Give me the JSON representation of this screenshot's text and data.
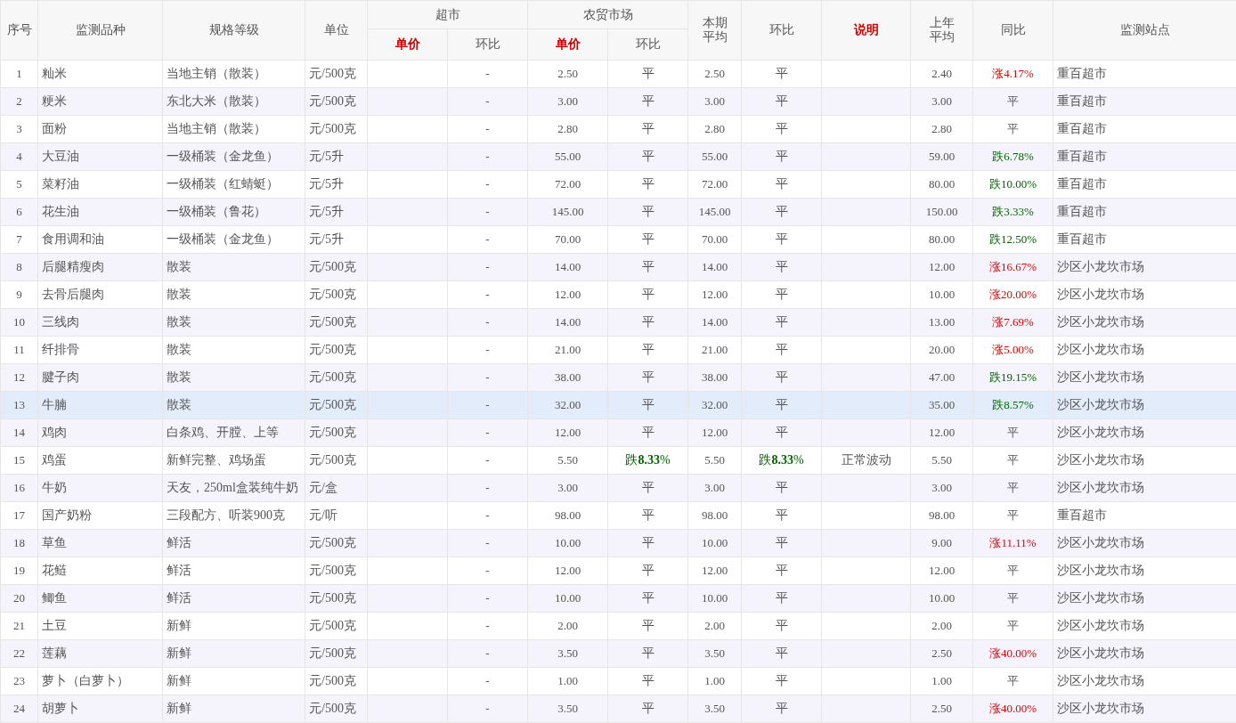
{
  "header": [
    {
      "label": "序号",
      "emphasis": false
    },
    {
      "label": "监测品种",
      "emphasis": false
    },
    {
      "label": "规格等级",
      "emphasis": false
    },
    {
      "label": "单位",
      "emphasis": false
    },
    {
      "label": "超市",
      "emphasis": false,
      "sub": [
        {
          "label": "单价",
          "emphasis": true
        },
        {
          "label": "环比",
          "emphasis": false
        }
      ]
    },
    {
      "label": "农贸市场",
      "emphasis": false,
      "sub": [
        {
          "label": "单价",
          "emphasis": true
        },
        {
          "label": "环比",
          "emphasis": false
        }
      ]
    },
    {
      "label": "本期平均",
      "emphasis": false
    },
    {
      "label": "环比",
      "emphasis": false
    },
    {
      "label": "说明",
      "emphasis": true
    },
    {
      "label": "上年平均",
      "emphasis": false
    },
    {
      "label": "同比",
      "emphasis": false
    },
    {
      "label": "监测站点",
      "emphasis": false
    }
  ],
  "rows": [
    {
      "no": "1",
      "name": "籼米",
      "spec": "当地主销（散装）",
      "unit": "元/500克",
      "super_change": "-",
      "farm_price": "2.50",
      "farm_change": {
        "text": "平",
        "kind": "flat"
      },
      "avg": "2.50",
      "avg_change": {
        "text": "平",
        "kind": "flat"
      },
      "last_year": "2.40",
      "yoy": {
        "text": "涨4.17%",
        "kind": "up"
      },
      "station": "重百超市",
      "selected": false
    },
    {
      "no": "2",
      "name": "粳米",
      "spec": "东北大米（散装）",
      "unit": "元/500克",
      "super_change": "-",
      "farm_price": "3.00",
      "farm_change": {
        "text": "平",
        "kind": "flat"
      },
      "avg": "3.00",
      "avg_change": {
        "text": "平",
        "kind": "flat"
      },
      "last_year": "3.00",
      "yoy": {
        "text": "平",
        "kind": "flat"
      },
      "station": "重百超市",
      "selected": false
    },
    {
      "no": "3",
      "name": "面粉",
      "spec": "当地主销（散装）",
      "unit": "元/500克",
      "super_change": "-",
      "farm_price": "2.80",
      "farm_change": {
        "text": "平",
        "kind": "flat"
      },
      "avg": "2.80",
      "avg_change": {
        "text": "平",
        "kind": "flat"
      },
      "last_year": "2.80",
      "yoy": {
        "text": "平",
        "kind": "flat"
      },
      "station": "重百超市",
      "selected": false
    },
    {
      "no": "4",
      "name": "大豆油",
      "spec": "一级桶装（金龙鱼）",
      "unit": "元/5升",
      "super_change": "-",
      "farm_price": "55.00",
      "farm_change": {
        "text": "平",
        "kind": "flat"
      },
      "avg": "55.00",
      "avg_change": {
        "text": "平",
        "kind": "flat"
      },
      "last_year": "59.00",
      "yoy": {
        "text": "跌6.78%",
        "kind": "down"
      },
      "station": "重百超市",
      "selected": false
    },
    {
      "no": "5",
      "name": "菜籽油",
      "spec": "一级桶装（红蜻蜓）",
      "unit": "元/5升",
      "super_change": "-",
      "farm_price": "72.00",
      "farm_change": {
        "text": "平",
        "kind": "flat"
      },
      "avg": "72.00",
      "avg_change": {
        "text": "平",
        "kind": "flat"
      },
      "last_year": "80.00",
      "yoy": {
        "text": "跌10.00%",
        "kind": "down"
      },
      "station": "重百超市",
      "selected": false
    },
    {
      "no": "6",
      "name": "花生油",
      "spec": "一级桶装（鲁花）",
      "unit": "元/5升",
      "super_change": "-",
      "farm_price": "145.00",
      "farm_change": {
        "text": "平",
        "kind": "flat"
      },
      "avg": "145.00",
      "avg_change": {
        "text": "平",
        "kind": "flat"
      },
      "last_year": "150.00",
      "yoy": {
        "text": "跌3.33%",
        "kind": "down"
      },
      "station": "重百超市",
      "selected": false
    },
    {
      "no": "7",
      "name": "食用调和油",
      "spec": "一级桶装（金龙鱼）",
      "unit": "元/5升",
      "super_change": "-",
      "farm_price": "70.00",
      "farm_change": {
        "text": "平",
        "kind": "flat"
      },
      "avg": "70.00",
      "avg_change": {
        "text": "平",
        "kind": "flat"
      },
      "last_year": "80.00",
      "yoy": {
        "text": "跌12.50%",
        "kind": "down"
      },
      "station": "重百超市",
      "selected": false
    },
    {
      "no": "8",
      "name": "后腿精瘦肉",
      "spec": "散装",
      "unit": "元/500克",
      "super_change": "-",
      "farm_price": "14.00",
      "farm_change": {
        "text": "平",
        "kind": "flat"
      },
      "avg": "14.00",
      "avg_change": {
        "text": "平",
        "kind": "flat"
      },
      "last_year": "12.00",
      "yoy": {
        "text": "涨16.67%",
        "kind": "up"
      },
      "station": "沙区小龙坎市场",
      "selected": false
    },
    {
      "no": "9",
      "name": "去骨后腿肉",
      "spec": "散装",
      "unit": "元/500克",
      "super_change": "-",
      "farm_price": "12.00",
      "farm_change": {
        "text": "平",
        "kind": "flat"
      },
      "avg": "12.00",
      "avg_change": {
        "text": "平",
        "kind": "flat"
      },
      "last_year": "10.00",
      "yoy": {
        "text": "涨20.00%",
        "kind": "up"
      },
      "station": "沙区小龙坎市场",
      "selected": false
    },
    {
      "no": "10",
      "name": "三线肉",
      "spec": "散装",
      "unit": "元/500克",
      "super_change": "-",
      "farm_price": "14.00",
      "farm_change": {
        "text": "平",
        "kind": "flat"
      },
      "avg": "14.00",
      "avg_change": {
        "text": "平",
        "kind": "flat"
      },
      "last_year": "13.00",
      "yoy": {
        "text": "涨7.69%",
        "kind": "up"
      },
      "station": "沙区小龙坎市场",
      "selected": false
    },
    {
      "no": "11",
      "name": "纤排骨",
      "spec": "散装",
      "unit": "元/500克",
      "super_change": "-",
      "farm_price": "21.00",
      "farm_change": {
        "text": "平",
        "kind": "flat"
      },
      "avg": "21.00",
      "avg_change": {
        "text": "平",
        "kind": "flat"
      },
      "last_year": "20.00",
      "yoy": {
        "text": "涨5.00%",
        "kind": "up"
      },
      "station": "沙区小龙坎市场",
      "selected": false
    },
    {
      "no": "12",
      "name": "腱子肉",
      "spec": "散装",
      "unit": "元/500克",
      "super_change": "-",
      "farm_price": "38.00",
      "farm_change": {
        "text": "平",
        "kind": "flat"
      },
      "avg": "38.00",
      "avg_change": {
        "text": "平",
        "kind": "flat"
      },
      "last_year": "47.00",
      "yoy": {
        "text": "跌19.15%",
        "kind": "down"
      },
      "station": "沙区小龙坎市场",
      "selected": false
    },
    {
      "no": "13",
      "name": "牛腩",
      "spec": "散装",
      "unit": "元/500克",
      "super_change": "-",
      "farm_price": "32.00",
      "farm_change": {
        "text": "平",
        "kind": "flat"
      },
      "avg": "32.00",
      "avg_change": {
        "text": "平",
        "kind": "flat"
      },
      "last_year": "35.00",
      "yoy": {
        "text": "跌8.57%",
        "kind": "down"
      },
      "station": "沙区小龙坎市场",
      "selected": true
    },
    {
      "no": "14",
      "name": "鸡肉",
      "spec": "白条鸡、开膛、上等",
      "unit": "元/500克",
      "super_change": "-",
      "farm_price": "12.00",
      "farm_change": {
        "text": "平",
        "kind": "flat"
      },
      "avg": "12.00",
      "avg_change": {
        "text": "平",
        "kind": "flat"
      },
      "last_year": "12.00",
      "yoy": {
        "text": "平",
        "kind": "flat"
      },
      "station": "沙区小龙坎市场",
      "selected": false
    },
    {
      "no": "15",
      "name": "鸡蛋",
      "spec": "新鲜完整、鸡场蛋",
      "unit": "元/500克",
      "super_change": "-",
      "farm_price": "5.50",
      "farm_change": {
        "text": "跌**8.33**%",
        "kind": "down"
      },
      "avg": "5.50",
      "avg_change": {
        "text": "跌**8.33**%",
        "kind": "down"
      },
      "note": "正常波动",
      "last_year": "5.50",
      "yoy": {
        "text": "平",
        "kind": "flat"
      },
      "station": "沙区小龙坎市场",
      "selected": false
    },
    {
      "no": "16",
      "name": "牛奶",
      "spec": "天友，250ml盒装纯牛奶",
      "unit": "元/盒",
      "super_change": "-",
      "farm_price": "3.00",
      "farm_change": {
        "text": "平",
        "kind": "flat"
      },
      "avg": "3.00",
      "avg_change": {
        "text": "平",
        "kind": "flat"
      },
      "last_year": "3.00",
      "yoy": {
        "text": "平",
        "kind": "flat"
      },
      "station": "沙区小龙坎市场",
      "selected": false
    },
    {
      "no": "17",
      "name": "国产奶粉",
      "spec": "三段配方、听装900克",
      "unit": "元/听",
      "super_change": "-",
      "farm_price": "98.00",
      "farm_change": {
        "text": "平",
        "kind": "flat"
      },
      "avg": "98.00",
      "avg_change": {
        "text": "平",
        "kind": "flat"
      },
      "last_year": "98.00",
      "yoy": {
        "text": "平",
        "kind": "flat"
      },
      "station": "重百超市",
      "selected": false
    },
    {
      "no": "18",
      "name": "草鱼",
      "spec": "鲜活",
      "unit": "元/500克",
      "super_change": "-",
      "farm_price": "10.00",
      "farm_change": {
        "text": "平",
        "kind": "flat"
      },
      "avg": "10.00",
      "avg_change": {
        "text": "平",
        "kind": "flat"
      },
      "last_year": "9.00",
      "yoy": {
        "text": "涨11.11%",
        "kind": "up"
      },
      "station": "沙区小龙坎市场",
      "selected": false
    },
    {
      "no": "19",
      "name": "花鲢",
      "spec": "鲜活",
      "unit": "元/500克",
      "super_change": "-",
      "farm_price": "12.00",
      "farm_change": {
        "text": "平",
        "kind": "flat"
      },
      "avg": "12.00",
      "avg_change": {
        "text": "平",
        "kind": "flat"
      },
      "last_year": "12.00",
      "yoy": {
        "text": "平",
        "kind": "flat"
      },
      "station": "沙区小龙坎市场",
      "selected": false
    },
    {
      "no": "20",
      "name": "鲫鱼",
      "spec": "鲜活",
      "unit": "元/500克",
      "super_change": "-",
      "farm_price": "10.00",
      "farm_change": {
        "text": "平",
        "kind": "flat"
      },
      "avg": "10.00",
      "avg_change": {
        "text": "平",
        "kind": "flat"
      },
      "last_year": "10.00",
      "yoy": {
        "text": "平",
        "kind": "flat"
      },
      "station": "沙区小龙坎市场",
      "selected": false
    },
    {
      "no": "21",
      "name": "土豆",
      "spec": "新鲜",
      "unit": "元/500克",
      "super_change": "-",
      "farm_price": "2.00",
      "farm_change": {
        "text": "平",
        "kind": "flat"
      },
      "avg": "2.00",
      "avg_change": {
        "text": "平",
        "kind": "flat"
      },
      "last_year": "2.00",
      "yoy": {
        "text": "平",
        "kind": "flat"
      },
      "station": "沙区小龙坎市场",
      "selected": false
    },
    {
      "no": "22",
      "name": "莲藕",
      "spec": "新鲜",
      "unit": "元/500克",
      "super_change": "-",
      "farm_price": "3.50",
      "farm_change": {
        "text": "平",
        "kind": "flat"
      },
      "avg": "3.50",
      "avg_change": {
        "text": "平",
        "kind": "flat"
      },
      "last_year": "2.50",
      "yoy": {
        "text": "涨40.00%",
        "kind": "up"
      },
      "station": "沙区小龙坎市场",
      "selected": false
    },
    {
      "no": "23",
      "name": "萝卜（白萝卜）",
      "spec": "新鲜",
      "unit": "元/500克",
      "super_change": "-",
      "farm_price": "1.00",
      "farm_change": {
        "text": "平",
        "kind": "flat"
      },
      "avg": "1.00",
      "avg_change": {
        "text": "平",
        "kind": "flat"
      },
      "last_year": "1.00",
      "yoy": {
        "text": "平",
        "kind": "flat"
      },
      "station": "沙区小龙坎市场",
      "selected": false
    },
    {
      "no": "24",
      "name": "胡萝卜",
      "spec": "新鲜",
      "unit": "元/500克",
      "super_change": "-",
      "farm_price": "3.50",
      "farm_change": {
        "text": "平",
        "kind": "flat"
      },
      "avg": "3.50",
      "avg_change": {
        "text": "平",
        "kind": "flat"
      },
      "last_year": "2.50",
      "yoy": {
        "text": "涨40.00%",
        "kind": "up"
      },
      "station": "沙区小龙坎市场",
      "selected": false
    }
  ]
}
